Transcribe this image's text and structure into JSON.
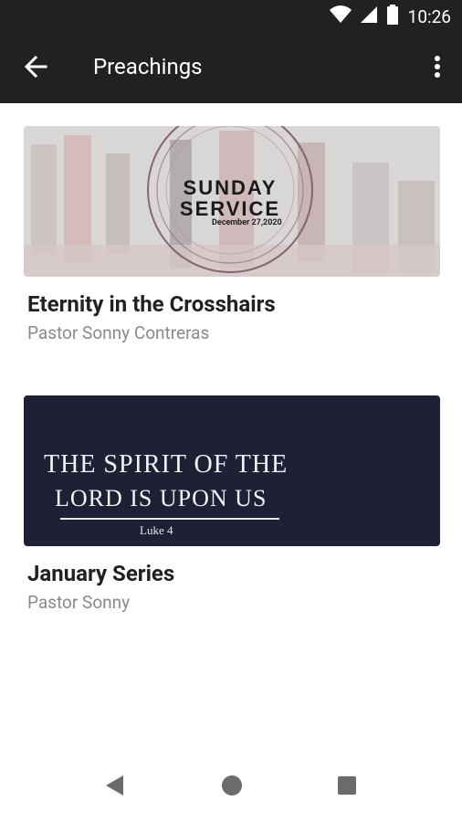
{
  "status_bar": {
    "time": "10:26",
    "icons": [
      "wifi-icon",
      "signal-icon",
      "battery-icon"
    ]
  },
  "app_bar": {
    "title": "Preachings",
    "back_icon": "arrow-left-icon",
    "more_icon": "more-vertical-icon"
  },
  "preachings": [
    {
      "title": "Eternity in the Crosshairs",
      "speaker": "Pastor Sonny Contreras",
      "thumbnail": {
        "heading": "SUNDAY SERVICE",
        "date": "December 27,2020"
      }
    },
    {
      "title": "January Series",
      "speaker": "Pastor Sonny",
      "thumbnail": {
        "line1": "THE SPIRIT OF THE",
        "line2": "LORD IS UPON US",
        "reference": "Luke 4"
      }
    }
  ],
  "nav_bar": {
    "back_icon": "triangle-back-icon",
    "home_icon": "circle-home-icon",
    "recents_icon": "square-recents-icon"
  },
  "colors": {
    "app_bar": "#212121",
    "title_text": "#212121",
    "subtitle_text": "#8a8a8a",
    "series_bg": "#1e2136"
  }
}
